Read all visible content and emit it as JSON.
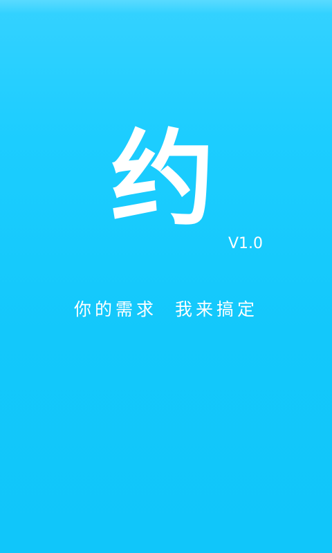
{
  "app": {
    "logo_text": "约",
    "version": "V1.0",
    "slogan": "你的需求  我来搞定"
  },
  "colors": {
    "background_top": "#35d2ff",
    "background_bottom": "#10c6fa",
    "text": "#ffffff"
  }
}
